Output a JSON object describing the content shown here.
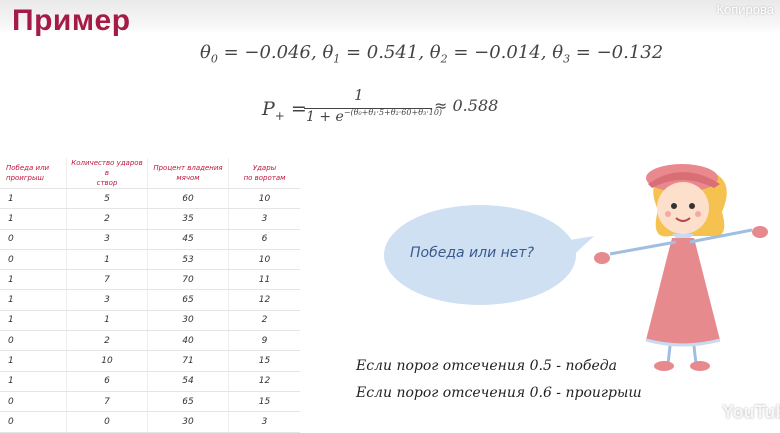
{
  "overlay": {
    "copy_label": "Копирова"
  },
  "slide": {
    "title": "Пример",
    "theta_line": {
      "t0": "θ",
      "t0_sub": "0",
      "t0_val": " = −0.046, ",
      "t1": "θ",
      "t1_sub": "1",
      "t1_val": " = 0.541, ",
      "t2": "θ",
      "t2_sub": "2",
      "t2_val": " = −0.014, ",
      "t3": "θ",
      "t3_sub": "3",
      "t3_val": " = −0.132"
    },
    "probability": {
      "lhs": "P",
      "lhs_sub": "+",
      "equals": " =",
      "numerator": "1",
      "denominator": "1 + e",
      "exponent": "−(θ₀+θ₁·5+θ₂·60+θ₃·10)",
      "approx": "≈ 0.588"
    },
    "table": {
      "headers": [
        [
          "Победа или",
          "проигрыш"
        ],
        [
          "Количество ударов в",
          "створ"
        ],
        [
          "Процент владения",
          "мячом"
        ],
        [
          "Удары",
          "по воротам"
        ]
      ],
      "rows": [
        [
          "1",
          "5",
          "60",
          "10"
        ],
        [
          "1",
          "2",
          "35",
          "3"
        ],
        [
          "0",
          "3",
          "45",
          "6"
        ],
        [
          "0",
          "1",
          "53",
          "10"
        ],
        [
          "1",
          "7",
          "70",
          "11"
        ],
        [
          "1",
          "3",
          "65",
          "12"
        ],
        [
          "1",
          "1",
          "30",
          "2"
        ],
        [
          "0",
          "2",
          "40",
          "9"
        ],
        [
          "1",
          "10",
          "71",
          "15"
        ],
        [
          "1",
          "6",
          "54",
          "12"
        ],
        [
          "0",
          "7",
          "65",
          "15"
        ],
        [
          "0",
          "0",
          "30",
          "3"
        ]
      ]
    },
    "bubble_text": "Победа или нет?",
    "notes": [
      "Если порог отсечения 0.5 - победа",
      "Если порог отсечения 0.6 - проигрыш"
    ]
  },
  "watermark": {
    "label": "YouTube"
  },
  "colors": {
    "title": "#a51a47",
    "header": "#c0143c",
    "bubble": "#cfe0f2",
    "dress": "#e68a8e"
  }
}
